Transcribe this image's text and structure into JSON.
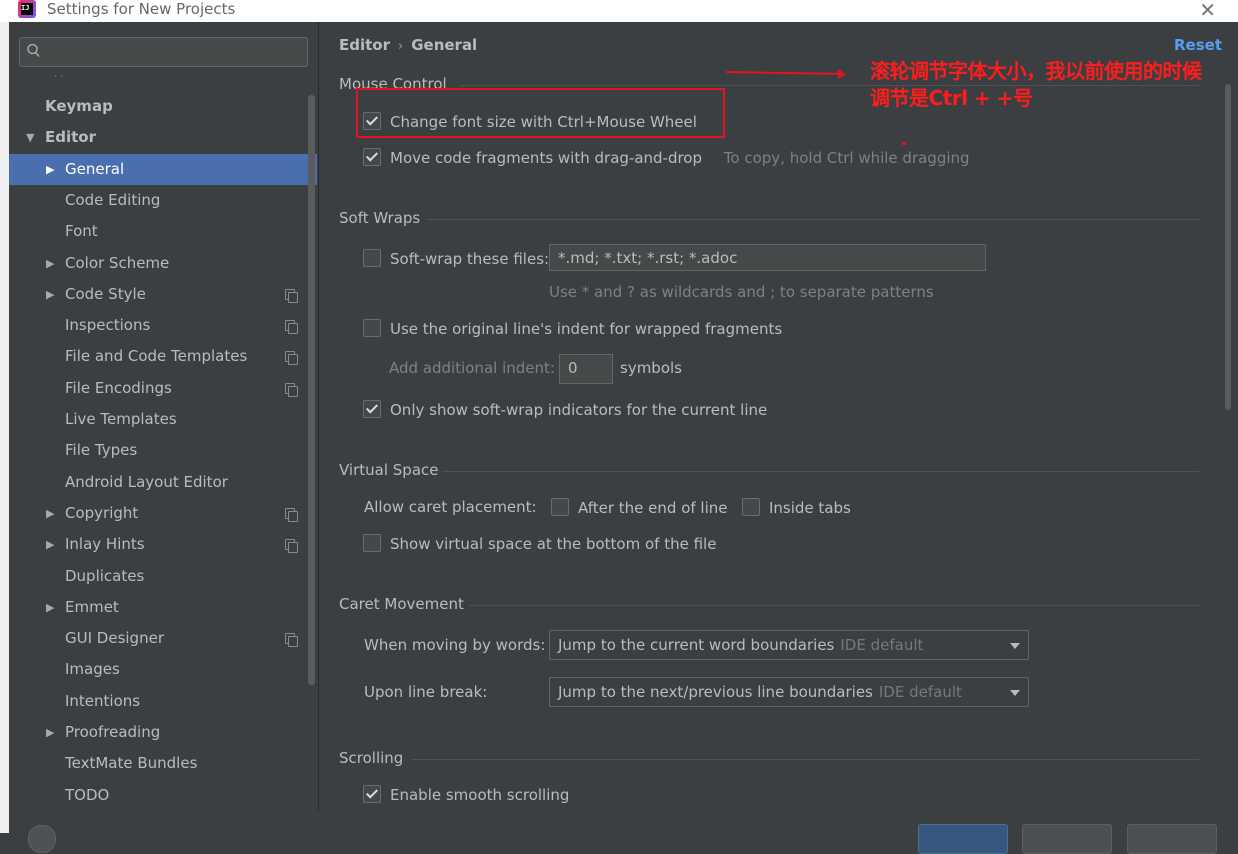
{
  "window": {
    "title": "Settings for New Projects",
    "close_glyph": "✕",
    "app_icon_text": "IJ"
  },
  "sidebar": {
    "search_placeholder": "",
    "items": [
      {
        "label": "Keymap",
        "bold": true,
        "indent": 0,
        "arrow": ""
      },
      {
        "label": "Editor",
        "bold": true,
        "indent": 0,
        "arrow": "▼"
      },
      {
        "label": "General",
        "indent": 1,
        "arrow": "▶",
        "selected": true
      },
      {
        "label": "Code Editing",
        "indent": 1,
        "arrow": ""
      },
      {
        "label": "Font",
        "indent": 1,
        "arrow": ""
      },
      {
        "label": "Color Scheme",
        "indent": 1,
        "arrow": "▶"
      },
      {
        "label": "Code Style",
        "indent": 1,
        "arrow": "▶",
        "copy": true
      },
      {
        "label": "Inspections",
        "indent": 1,
        "arrow": "",
        "copy": true
      },
      {
        "label": "File and Code Templates",
        "indent": 1,
        "arrow": "",
        "copy": true
      },
      {
        "label": "File Encodings",
        "indent": 1,
        "arrow": "",
        "copy": true
      },
      {
        "label": "Live Templates",
        "indent": 1,
        "arrow": ""
      },
      {
        "label": "File Types",
        "indent": 1,
        "arrow": ""
      },
      {
        "label": "Android Layout Editor",
        "indent": 1,
        "arrow": ""
      },
      {
        "label": "Copyright",
        "indent": 1,
        "arrow": "▶",
        "copy": true
      },
      {
        "label": "Inlay Hints",
        "indent": 1,
        "arrow": "▶",
        "copy": true
      },
      {
        "label": "Duplicates",
        "indent": 1,
        "arrow": ""
      },
      {
        "label": "Emmet",
        "indent": 1,
        "arrow": "▶"
      },
      {
        "label": "GUI Designer",
        "indent": 1,
        "arrow": "",
        "copy": true
      },
      {
        "label": "Images",
        "indent": 1,
        "arrow": ""
      },
      {
        "label": "Intentions",
        "indent": 1,
        "arrow": ""
      },
      {
        "label": "Proofreading",
        "indent": 1,
        "arrow": "▶"
      },
      {
        "label": "TextMate Bundles",
        "indent": 1,
        "arrow": ""
      },
      {
        "label": "TODO",
        "indent": 1,
        "arrow": ""
      }
    ]
  },
  "header": {
    "crumb_parent": "Editor",
    "crumb_sep": "›",
    "crumb_current": "General",
    "reset": "Reset"
  },
  "mouse_control": {
    "title": "Mouse Control",
    "change_font_size": {
      "label": "Change font size with Ctrl+Mouse Wheel",
      "checked": true
    },
    "move_fragments": {
      "label": "Move code fragments with drag-and-drop",
      "checked": true,
      "hint": "To copy, hold Ctrl while dragging"
    }
  },
  "soft_wraps": {
    "title": "Soft Wraps",
    "soft_wrap_files": {
      "label": "Soft-wrap these files:",
      "checked": false,
      "value": "*.md; *.txt; *.rst; *.adoc"
    },
    "wildcard_hint": "Use * and ? as wildcards and ; to separate patterns",
    "original_indent": {
      "label": "Use the original line's indent for wrapped fragments",
      "checked": false
    },
    "additional_indent_label": "Add additional indent:",
    "additional_indent_value": "0",
    "symbols_label": "symbols",
    "only_show_indicators": {
      "label": "Only show soft-wrap indicators for the current line",
      "checked": true
    }
  },
  "virtual_space": {
    "title": "Virtual Space",
    "allow_caret_label": "Allow caret placement:",
    "after_end": {
      "label": "After the end of line",
      "checked": false
    },
    "inside_tabs": {
      "label": "Inside tabs",
      "checked": false
    },
    "show_virtual_bottom": {
      "label": "Show virtual space at the bottom of the file",
      "checked": false
    }
  },
  "caret_movement": {
    "title": "Caret Movement",
    "moving_words_label": "When moving by words:",
    "moving_words_value": "Jump to the current word boundaries",
    "moving_words_sub": "IDE default",
    "line_break_label": "Upon line break:",
    "line_break_value": "Jump to the next/previous line boundaries",
    "line_break_sub": "IDE default"
  },
  "scrolling": {
    "title": "Scrolling",
    "smooth": {
      "label": "Enable smooth scrolling",
      "checked": true
    }
  },
  "annotation": {
    "line1": "滚轮调节字体大小，我以前使用的时候",
    "line2": "调节是Ctrl + +号"
  }
}
